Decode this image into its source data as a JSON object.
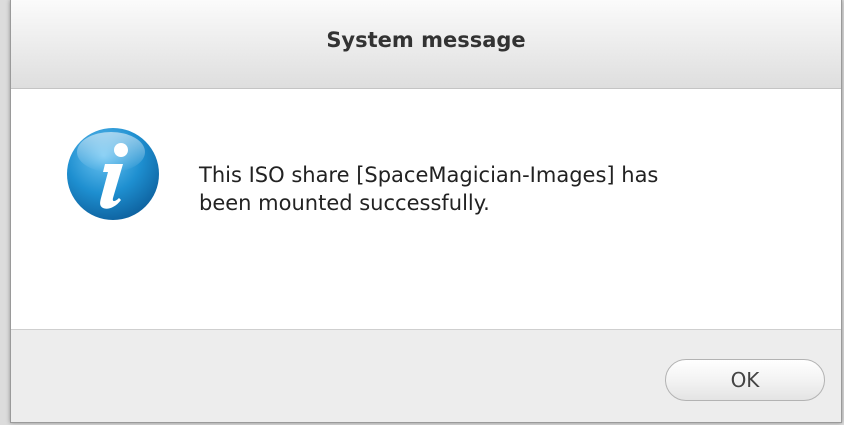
{
  "dialog": {
    "title": "System message",
    "message_line1": "This ISO share [SpaceMagician-Images] has",
    "message_line2": "been mounted successfully.",
    "icon": "info-icon",
    "ok_label": "OK"
  },
  "colors": {
    "icon_blue": "#1e8fd0",
    "icon_blue_dark": "#0d5f9c",
    "footer_bg": "#ededed"
  }
}
